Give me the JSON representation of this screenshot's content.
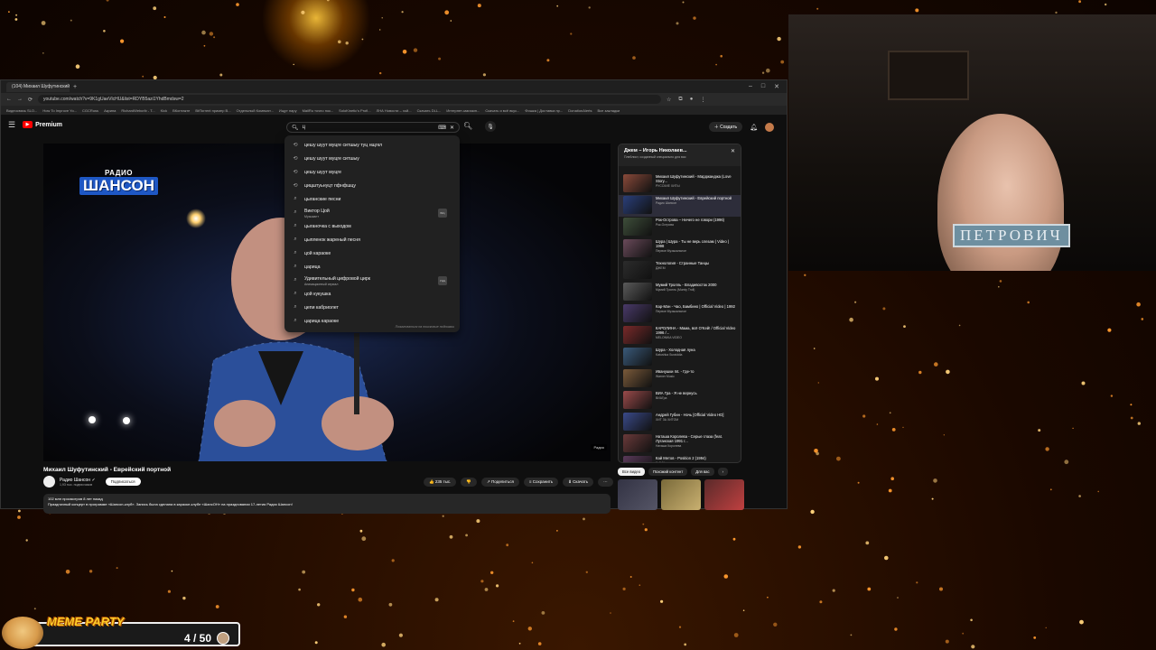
{
  "browser": {
    "tab_title": "(104) Михаил Шуфутинский",
    "new_tab": "+",
    "window_controls": [
      "–",
      "□",
      "✕"
    ],
    "url": "youtube.com/watch?v=9K1gUaeVlcHU&list=RDYB5azi1YhdBmdsw=2",
    "bookmarks": [
      "Видеосвязь SLO...",
      "How To Improve Yo...",
      "CGCRuss",
      "Акрина",
      "RichardWebcrib - T...",
      "Kick",
      "ВКонтакте",
      "BitTorrent пример В...",
      "Отдельный Компьют...",
      "Ищут пару",
      "MailRu точно пок...",
      "SoloKinetic's Profi...",
      "ЛНА Новости – хой...",
      "Скачать DLL...",
      "Интернет-магазин...",
      "Скачать и всё вкус...",
      "Фишка | Доставка пр...",
      "DonationAlerts",
      "Все закладки"
    ]
  },
  "yt": {
    "logo_text": "Premium",
    "search_query": "ц",
    "create_label": "Создать",
    "notif_count": "9+"
  },
  "suggestions": [
    {
      "text": "цешу шуут муцге ситшыу туц нщгкл",
      "icon": "history-icon"
    },
    {
      "text": "цешу шуут муцге ситшыу",
      "icon": "history-icon"
    },
    {
      "text": "цешу шуут муцге",
      "icon": "history-icon"
    },
    {
      "text": "цицштуьнуцт пфнфшцу",
      "icon": "history-icon"
    },
    {
      "text": "цыганские песни",
      "icon": "search-icon"
    },
    {
      "text": "Виктор Цой",
      "sub": "Музыкант",
      "icon": "search-icon",
      "thumb": "В/Ц"
    },
    {
      "text": "цыганочка с выходом",
      "icon": "search-icon"
    },
    {
      "text": "цыпленок жареный песня",
      "icon": "search-icon"
    },
    {
      "text": "цой караоке",
      "icon": "search-icon"
    },
    {
      "text": "царица",
      "icon": "search-icon"
    },
    {
      "text": "Удивительный цифровой цирк",
      "sub": "Анимационный сериал",
      "icon": "search-icon",
      "thumb": "УЦЦ"
    },
    {
      "text": "цой кукушка",
      "icon": "search-icon"
    },
    {
      "text": "цепи кабриолет",
      "icon": "search-icon"
    },
    {
      "text": "царица караоке",
      "icon": "search-icon"
    }
  ],
  "dropdown_footer": "Пожаловаться на поисковые подсказки",
  "video": {
    "logo_line1": "РАДИО",
    "logo_line2": "ШАНСОН",
    "badge": "Радио",
    "title": "Михаил Шуфутинский - Еврейский портной",
    "channel": "Радио Шансон ✓",
    "subs": "1,93 тыс. подписчиков",
    "subscribe": "Подписаться",
    "likes": "👍 235 тыс.",
    "dislike": "👎",
    "share": "↗ Поделиться",
    "save": "≡ Сохранить",
    "download": "⬇ Скачать",
    "more": "⋯",
    "desc_line1": "102 млн просмотров  8 лет назад",
    "desc_line2": "Праздничный концерт в программе «Шансон-клуб». Запись была сделана в караоке-клубе «ШансОН» на праздновании 17-летия Радио Шансон!"
  },
  "playlist": {
    "title": "Джем – Игорь Николаев...",
    "subtitle": "Плейлист, созданный специально для вас",
    "close": "✕",
    "items": [
      {
        "name": "Михаил Шуфутинский - Марджанджа (Love Story...",
        "channel": "РУССКИЕ ХИТЫ",
        "color": "#8a4a3a"
      },
      {
        "name": "Михаил Шуфутинский - Еврейский портной",
        "channel": "Радио Шансон",
        "color": "#2a3f7a",
        "active": true
      },
      {
        "name": "Рок-Острова – Ничего не говори (1996)",
        "channel": "Рок-Острова",
        "color": "#3e4e3a"
      },
      {
        "name": "Шура | Шура - Ты не верь слезам | Video | 1998",
        "channel": "Первое Музыкальное",
        "color": "#6a4a5a"
      },
      {
        "name": "Технология - Странные Танцы",
        "channel": "ДЖЕМ",
        "color": "#2c2c2c"
      },
      {
        "name": "Мумий Тролль - Владивосток 2000",
        "channel": "Мумий Тролль (Mumiy Troll)",
        "color": "#5a5a5a"
      },
      {
        "name": "Кар-Мэн - Чао, Бамбино | Official Video | 1992",
        "channel": "Первое Музыкальное",
        "color": "#4a3a6a"
      },
      {
        "name": "КАРОЛИНА - Мама, всё O'Kей! / Official Video 1996 /...",
        "channel": "MELONIKA VIDEO",
        "color": "#7a2a2a"
      },
      {
        "name": "Шура - Холодная луна",
        "channel": "Katushka Suraiddia",
        "color": "#3a5a7a"
      },
      {
        "name": "Иванушки Int. - Где-то",
        "channel": "Warner Music",
        "color": "#7a5a3a"
      },
      {
        "name": "ВИА Гра - Я не вернусь",
        "channel": "ВИАГра",
        "color": "#9a4a4a"
      },
      {
        "name": "Андрей Губин - Ночь [Official Video HD]",
        "channel": "ХИТ ЗА ХИТОМ",
        "color": "#3a4a8a"
      },
      {
        "name": "Наташа Королева - Серые глаза (feat. Луганская 1991 г...",
        "channel": "Наташа Королева",
        "color": "#6a3a3a"
      },
      {
        "name": "Кай Метов - Position 2 (1994)",
        "channel": "Кай Метов",
        "color": "#5a3a5a"
      }
    ]
  },
  "chips": [
    {
      "label": "Все видео",
      "active": true
    },
    {
      "label": "Похожий контент",
      "active": false
    },
    {
      "label": "Для вас",
      "active": false
    },
    {
      "label": "›",
      "active": false
    }
  ],
  "webcam": {
    "label": "ПЕТРОВИЧ"
  },
  "meme_party": {
    "title": "MEME PARTY",
    "count": "4 / 50"
  },
  "colors": {
    "yt_bg": "#0f0f0f",
    "brand_red": "#ff0000",
    "meme_yellow": "#ffcc2a"
  }
}
